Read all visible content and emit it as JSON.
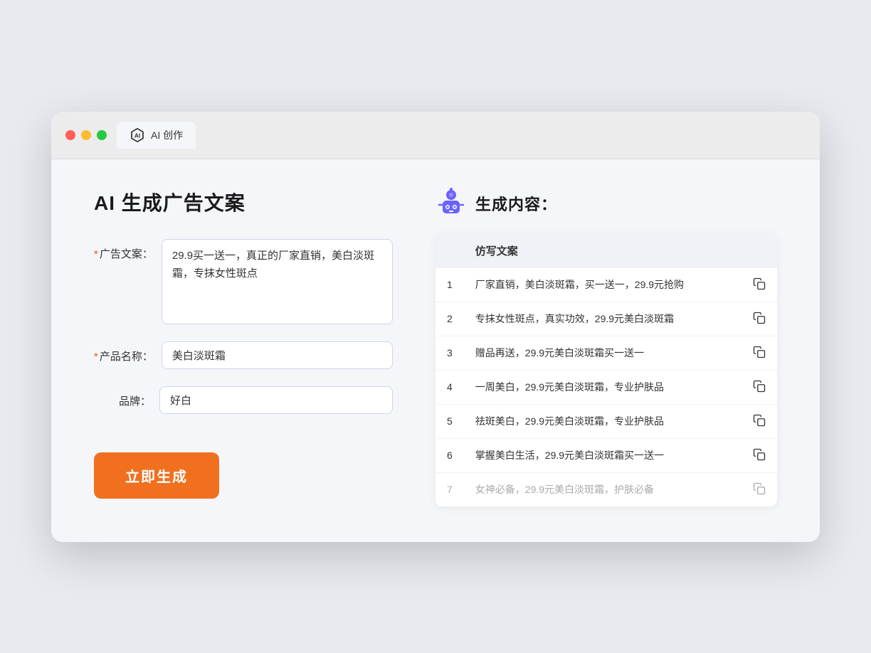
{
  "window": {
    "tab_label": "AI 创作"
  },
  "left": {
    "title": "AI 生成广告文案",
    "fields": [
      {
        "id": "ad_copy",
        "label": "广告文案：",
        "required": true,
        "type": "textarea",
        "value": "29.9买一送一，真正的厂家直销，美白淡斑霜，专抹女性斑点"
      },
      {
        "id": "product_name",
        "label": "产品名称：",
        "required": true,
        "type": "input",
        "value": "美白淡斑霜"
      },
      {
        "id": "brand",
        "label": "品牌：",
        "required": false,
        "type": "input",
        "value": "好白"
      }
    ],
    "button_label": "立即生成"
  },
  "right": {
    "title": "生成内容：",
    "table_header": "仿写文案",
    "rows": [
      {
        "num": 1,
        "text": "厂家直销，美白淡斑霜，买一送一，29.9元抢购",
        "dimmed": false
      },
      {
        "num": 2,
        "text": "专抹女性斑点，真实功效，29.9元美白淡斑霜",
        "dimmed": false
      },
      {
        "num": 3,
        "text": "赠品再送，29.9元美白淡斑霜买一送一",
        "dimmed": false
      },
      {
        "num": 4,
        "text": "一周美白，29.9元美白淡斑霜，专业护肤品",
        "dimmed": false
      },
      {
        "num": 5,
        "text": "祛斑美白，29.9元美白淡斑霜，专业护肤品",
        "dimmed": false
      },
      {
        "num": 6,
        "text": "掌握美白生活，29.9元美白淡斑霜买一送一",
        "dimmed": false
      },
      {
        "num": 7,
        "text": "女神必备，29.9元美白淡斑霜，护肤必备",
        "dimmed": true
      }
    ]
  }
}
